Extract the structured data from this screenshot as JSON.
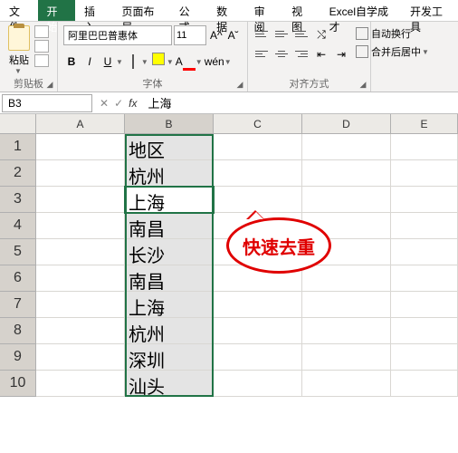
{
  "menu": {
    "file": "文件",
    "home": "开始",
    "insert": "插入",
    "layout": "页面布局",
    "formula": "公式",
    "data": "数据",
    "review": "审阅",
    "view": "视图",
    "custom": "Excel自学成才",
    "dev": "开发工具"
  },
  "ribbon": {
    "clipboard": {
      "paste": "粘贴",
      "label": "剪贴板"
    },
    "font": {
      "name": "阿里巴巴普惠体",
      "size": "11",
      "label": "字体",
      "wen": "wén"
    },
    "align": {
      "wrap": "自动换行",
      "merge": "合并后居中",
      "label": "对齐方式"
    }
  },
  "namebox": "B3",
  "fx": "fx",
  "formula_value": "上海",
  "columns": [
    "A",
    "B",
    "C",
    "D",
    "E"
  ],
  "rows": [
    "1",
    "2",
    "3",
    "4",
    "5",
    "6",
    "7",
    "8",
    "9",
    "10"
  ],
  "cells_B": [
    "地区",
    "杭州",
    "上海",
    "南昌",
    "长沙",
    "南昌",
    "上海",
    "杭州",
    "深圳",
    "汕头"
  ],
  "callout": "快速去重"
}
